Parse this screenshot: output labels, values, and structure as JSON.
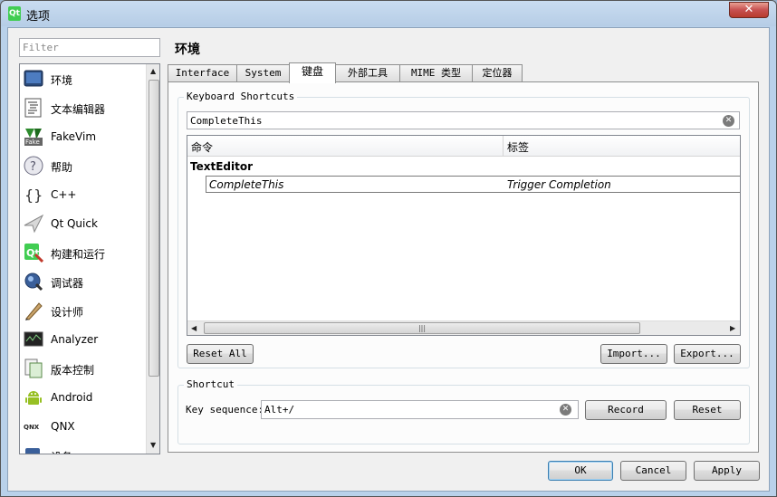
{
  "window": {
    "title": "选项",
    "app_icon": "Qt",
    "close_glyph": "✕"
  },
  "filter": {
    "placeholder": "Filter"
  },
  "sidebar": {
    "items": [
      {
        "label": "环境",
        "icon": "environment-icon"
      },
      {
        "label": "文本编辑器",
        "icon": "text-editor-icon"
      },
      {
        "label": "FakeVim",
        "icon": "fakevim-icon"
      },
      {
        "label": "帮助",
        "icon": "help-icon"
      },
      {
        "label": "C++",
        "icon": "cpp-icon"
      },
      {
        "label": "Qt Quick",
        "icon": "qt-quick-icon"
      },
      {
        "label": "构建和运行",
        "icon": "build-run-icon"
      },
      {
        "label": "调试器",
        "icon": "debugger-icon"
      },
      {
        "label": "设计师",
        "icon": "designer-icon"
      },
      {
        "label": "Analyzer",
        "icon": "analyzer-icon"
      },
      {
        "label": "版本控制",
        "icon": "version-control-icon"
      },
      {
        "label": "Android",
        "icon": "android-icon"
      },
      {
        "label": "QNX",
        "icon": "qnx-icon"
      },
      {
        "label": "设备",
        "icon": "devices-icon"
      }
    ]
  },
  "page_title": "环境",
  "tabs": [
    {
      "label": "Interface"
    },
    {
      "label": "System"
    },
    {
      "label": "键盘",
      "active": true
    },
    {
      "label": "外部工具"
    },
    {
      "label": "MIME 类型"
    },
    {
      "label": "定位器"
    }
  ],
  "shortcuts": {
    "group_title": "Keyboard Shortcuts",
    "search_value": "CompleteThis",
    "columns": [
      "命令",
      "标签"
    ],
    "category": "TextEditor",
    "rows": [
      {
        "command": "CompleteThis",
        "label": "Trigger Completion"
      }
    ],
    "hscroll_grip": "|||",
    "reset_all": "Reset All",
    "import": "Import...",
    "export": "Export..."
  },
  "shortcut": {
    "group_title": "Shortcut",
    "key_label": "Key sequence:",
    "key_value": "Alt+/",
    "record": "Record",
    "reset": "Reset"
  },
  "dialog_buttons": {
    "ok": "OK",
    "cancel": "Cancel",
    "apply": "Apply"
  },
  "colors": {
    "titlebar": "#b9d1ea",
    "close": "#c75050",
    "selection": "#3c7fb1"
  }
}
